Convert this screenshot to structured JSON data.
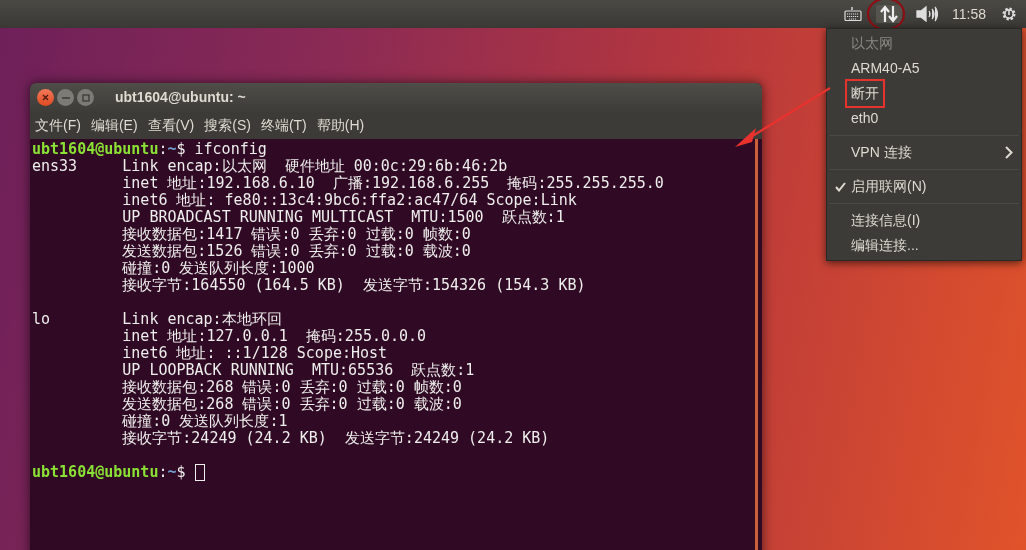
{
  "top_panel": {
    "time": "11:58",
    "network_menu_open": true
  },
  "terminal": {
    "title": "ubt1604@ubuntu: ~",
    "menu": [
      "文件(F)",
      "编辑(E)",
      "查看(V)",
      "搜索(S)",
      "终端(T)",
      "帮助(H)"
    ],
    "blocks": [
      [
        {
          "kind": "prompt",
          "user_host": "ubt1604@ubuntu",
          "colon": ":",
          "path": "~",
          "symbol": "$",
          "command": "ifconfig",
          "cursor": false
        },
        {
          "kind": "output",
          "text": "ens33     Link encap:以太网  硬件地址 00:0c:29:6b:46:2b"
        },
        {
          "kind": "output",
          "text": "          inet 地址:192.168.6.10  广播:192.168.6.255  掩码:255.255.255.0"
        },
        {
          "kind": "output",
          "text": "          inet6 地址: fe80::13c4:9bc6:ffa2:ac47/64 Scope:Link"
        },
        {
          "kind": "output",
          "text": "          UP BROADCAST RUNNING MULTICAST  MTU:1500  跃点数:1"
        },
        {
          "kind": "output",
          "text": "          接收数据包:1417 错误:0 丢弃:0 过载:0 帧数:0"
        },
        {
          "kind": "output",
          "text": "          发送数据包:1526 错误:0 丢弃:0 过载:0 载波:0"
        },
        {
          "kind": "output",
          "text": "          碰撞:0 发送队列长度:1000"
        },
        {
          "kind": "output",
          "text": "          接收字节:164550 (164.5 KB)  发送字节:154326 (154.3 KB)"
        }
      ],
      [
        {
          "kind": "output",
          "text": "lo        Link encap:本地环回"
        },
        {
          "kind": "output",
          "text": "          inet 地址:127.0.0.1  掩码:255.0.0.0"
        },
        {
          "kind": "output",
          "text": "          inet6 地址: ::1/128 Scope:Host"
        },
        {
          "kind": "output",
          "text": "          UP LOOPBACK RUNNING  MTU:65536  跃点数:1"
        },
        {
          "kind": "output",
          "text": "          接收数据包:268 错误:0 丢弃:0 过载:0 帧数:0"
        },
        {
          "kind": "output",
          "text": "          发送数据包:268 错误:0 丢弃:0 过载:0 载波:0"
        },
        {
          "kind": "output",
          "text": "          碰撞:0 发送队列长度:1"
        },
        {
          "kind": "output",
          "text": "          接收字节:24249 (24.2 KB)  发送字节:24249 (24.2 KB)"
        }
      ],
      [
        {
          "kind": "prompt",
          "user_host": "ubt1604@ubuntu",
          "colon": ":",
          "path": "~",
          "symbol": "$",
          "cursor": true
        }
      ]
    ]
  },
  "network_menu": {
    "sections": [
      [
        {
          "kind": "item",
          "label": "以太网",
          "disabled": true,
          "marked": false
        },
        {
          "kind": "item",
          "label": "ARM40-A5",
          "disabled": false,
          "marked": false
        },
        {
          "kind": "item",
          "label": "断开",
          "disabled": false,
          "marked": true
        },
        {
          "kind": "item",
          "label": "eth0",
          "disabled": false,
          "marked": false
        }
      ],
      [
        {
          "kind": "submenu",
          "label": "VPN 连接",
          "disabled": false,
          "marked": false
        }
      ],
      [
        {
          "kind": "check",
          "label": "启用联网(N)",
          "checked": true,
          "disabled": false,
          "marked": false
        }
      ],
      [
        {
          "kind": "item",
          "label": "连接信息(I)",
          "disabled": false,
          "marked": false
        },
        {
          "kind": "item",
          "label": "编辑连接...",
          "disabled": false,
          "marked": false
        }
      ]
    ]
  }
}
